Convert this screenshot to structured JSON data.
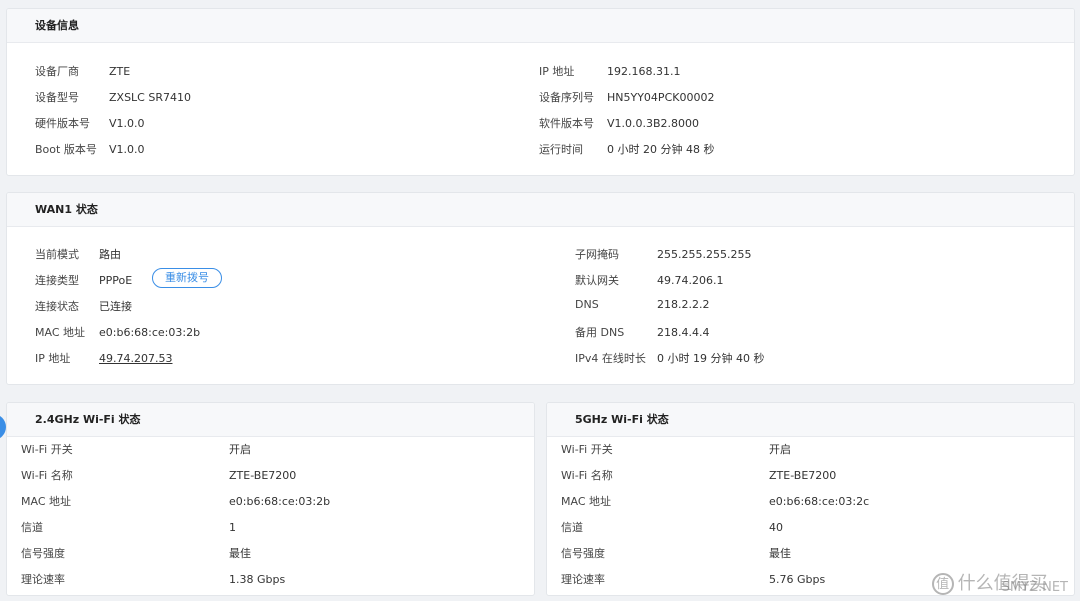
{
  "device_info": {
    "title": "设备信息",
    "left": [
      {
        "label": "设备厂商",
        "value": "ZTE"
      },
      {
        "label": "设备型号",
        "value": "ZXSLC SR7410"
      },
      {
        "label": "硬件版本号",
        "value": "V1.0.0"
      },
      {
        "label": "Boot 版本号",
        "value": "V1.0.0"
      }
    ],
    "right": [
      {
        "label": "IP 地址",
        "value": "192.168.31.1"
      },
      {
        "label": "设备序列号",
        "value": "HN5YY04PCK00002"
      },
      {
        "label": "软件版本号",
        "value": "V1.0.0.3B2.8000"
      },
      {
        "label": "运行时间",
        "value": "0 小时 20 分钟 48 秒"
      }
    ]
  },
  "wan": {
    "title": "WAN1 状态",
    "left": [
      {
        "label": "当前模式",
        "value": "路由"
      },
      {
        "label": "连接类型",
        "value": "PPPoE"
      },
      {
        "label": "连接状态",
        "value": "已连接"
      },
      {
        "label": "MAC 地址",
        "value": "e0:b6:68:ce:03:2b"
      },
      {
        "label": "IP 地址",
        "value": "49.74.207.53"
      }
    ],
    "redial_label": "重新拨号",
    "right": [
      {
        "label": "子网掩码",
        "value": "255.255.255.255"
      },
      {
        "label": "默认网关",
        "value": "49.74.206.1"
      },
      {
        "label": "DNS",
        "value": "218.2.2.2"
      },
      {
        "label": "备用 DNS",
        "value": "218.4.4.4"
      },
      {
        "label": "IPv4 在线时长",
        "value": "0 小时 19 分钟 40 秒"
      }
    ]
  },
  "wifi24": {
    "title": "2.4GHz Wi-Fi 状态",
    "rows": [
      {
        "label": "Wi-Fi 开关",
        "value": "开启"
      },
      {
        "label": "Wi-Fi 名称",
        "value": "ZTE-BE7200"
      },
      {
        "label": "MAC 地址",
        "value": "e0:b6:68:ce:03:2b"
      },
      {
        "label": "信道",
        "value": "1"
      },
      {
        "label": "信号强度",
        "value": "最佳"
      },
      {
        "label": "理论速率",
        "value": "1.38 Gbps"
      }
    ]
  },
  "wifi5": {
    "title": "5GHz Wi-Fi 状态",
    "rows": [
      {
        "label": "Wi-Fi 开关",
        "value": "开启"
      },
      {
        "label": "Wi-Fi 名称",
        "value": "ZTE-BE7200"
      },
      {
        "label": "MAC 地址",
        "value": "e0:b6:68:ce:03:2c"
      },
      {
        "label": "信道",
        "value": "40"
      },
      {
        "label": "信号强度",
        "value": "最佳"
      },
      {
        "label": "理论速率",
        "value": "5.76 Gbps"
      }
    ]
  },
  "watermark": {
    "icon_text": "值",
    "text": "什么值得买",
    "site": "SMYZ.NET"
  },
  "colors": {
    "accent": "#3a8ee6",
    "panel_header": "#f7f8fa",
    "background": "#f0f2f5"
  }
}
